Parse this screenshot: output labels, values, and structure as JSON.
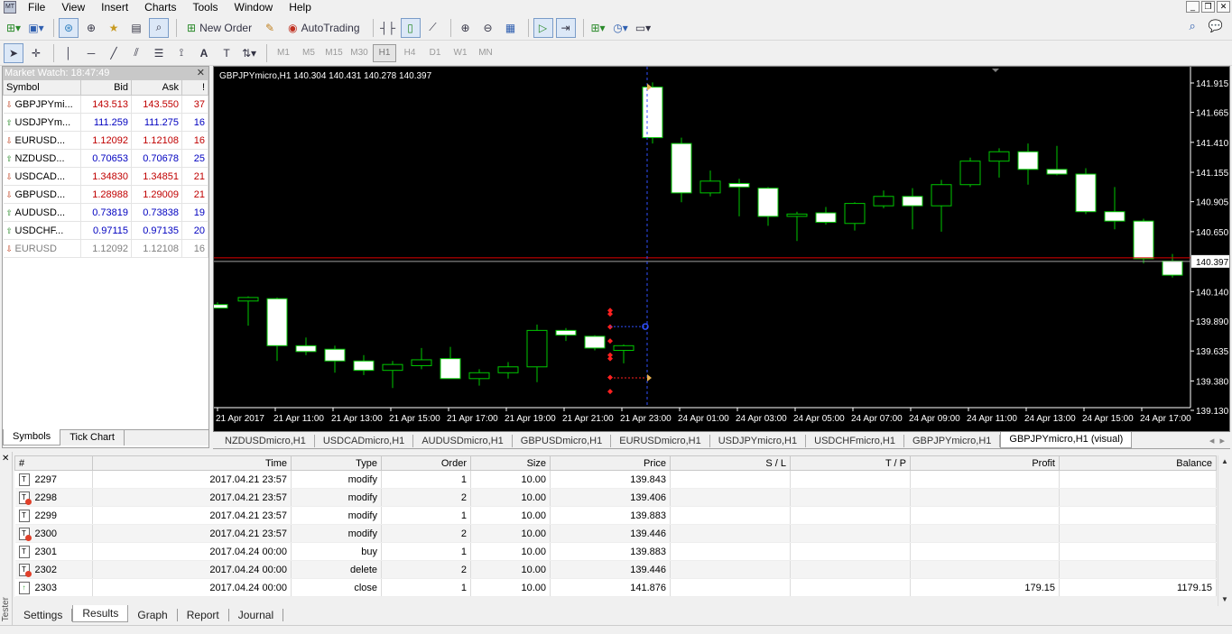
{
  "menu": {
    "items": [
      "File",
      "View",
      "Insert",
      "Charts",
      "Tools",
      "Window",
      "Help"
    ]
  },
  "toolbar": {
    "new_order_label": "New Order",
    "autotrading_label": "AutoTrading",
    "timeframes": [
      "M1",
      "M5",
      "M15",
      "M30",
      "H1",
      "H4",
      "D1",
      "W1",
      "MN"
    ],
    "active_timeframe": "H1"
  },
  "market_watch": {
    "title": "Market Watch: 18:47:49",
    "columns": [
      "Symbol",
      "Bid",
      "Ask",
      "!"
    ],
    "rows": [
      {
        "symbol": "GBPJPYmi...",
        "bid": "143.513",
        "ask": "143.550",
        "spread": "37",
        "dir": "down"
      },
      {
        "symbol": "USDJPYm...",
        "bid": "111.259",
        "ask": "111.275",
        "spread": "16",
        "dir": "up"
      },
      {
        "symbol": "EURUSD...",
        "bid": "1.12092",
        "ask": "1.12108",
        "spread": "16",
        "dir": "down"
      },
      {
        "symbol": "NZDUSD...",
        "bid": "0.70653",
        "ask": "0.70678",
        "spread": "25",
        "dir": "up"
      },
      {
        "symbol": "USDCAD...",
        "bid": "1.34830",
        "ask": "1.34851",
        "spread": "21",
        "dir": "down"
      },
      {
        "symbol": "GBPUSD...",
        "bid": "1.28988",
        "ask": "1.29009",
        "spread": "21",
        "dir": "down"
      },
      {
        "symbol": "AUDUSD...",
        "bid": "0.73819",
        "ask": "0.73838",
        "spread": "19",
        "dir": "up"
      },
      {
        "symbol": "USDCHF...",
        "bid": "0.97115",
        "ask": "0.97135",
        "spread": "20",
        "dir": "up"
      },
      {
        "symbol": "EURUSD",
        "bid": "1.12092",
        "ask": "1.12108",
        "spread": "16",
        "dir": "down-gray"
      }
    ],
    "tabs": [
      "Symbols",
      "Tick Chart"
    ]
  },
  "chart": {
    "header": "GBPJPYmicro,H1  140.304 140.431 140.278 140.397",
    "current_price": "140.397",
    "price_ticks": [
      "141.915",
      "141.665",
      "141.410",
      "141.155",
      "140.905",
      "140.650",
      "140.140",
      "139.890",
      "139.635",
      "139.380",
      "139.130"
    ],
    "time_ticks": [
      "21 Apr 2017",
      "21 Apr 11:00",
      "21 Apr 13:00",
      "21 Apr 15:00",
      "21 Apr 17:00",
      "21 Apr 19:00",
      "21 Apr 21:00",
      "21 Apr 23:00",
      "24 Apr 01:00",
      "24 Apr 03:00",
      "24 Apr 05:00",
      "24 Apr 07:00",
      "24 Apr 09:00",
      "24 Apr 11:00",
      "24 Apr 13:00",
      "24 Apr 15:00",
      "24 Apr 17:00"
    ],
    "colors": {
      "background": "#000000",
      "bull_fill": "#000000",
      "bear_fill": "#ffffff",
      "wick": "#00c800",
      "price_line": "#e00000",
      "crosshair": "#3050ff"
    }
  },
  "chart_tabs": {
    "items": [
      "NZDUSDmicro,H1",
      "USDCADmicro,H1",
      "AUDUSDmicro,H1",
      "GBPUSDmicro,H1",
      "EURUSDmicro,H1",
      "USDJPYmicro,H1",
      "USDCHFmicro,H1",
      "GBPJPYmicro,H1",
      "GBPJPYmicro,H1 (visual)"
    ],
    "active": "GBPJPYmicro,H1 (visual)"
  },
  "results": {
    "columns": [
      "#",
      "Time",
      "Type",
      "Order",
      "Size",
      "Price",
      "S / L",
      "T / P",
      "Profit",
      "Balance"
    ],
    "rows": [
      {
        "id": "2297",
        "time": "2017.04.21 23:57",
        "type": "modify",
        "order": "1",
        "size": "10.00",
        "price": "139.843",
        "sl": "",
        "tp": "",
        "profit": "",
        "balance": "",
        "icon": "modify-buy"
      },
      {
        "id": "2298",
        "time": "2017.04.21 23:57",
        "type": "modify",
        "order": "2",
        "size": "10.00",
        "price": "139.406",
        "sl": "",
        "tp": "",
        "profit": "",
        "balance": "",
        "icon": "modify-sell"
      },
      {
        "id": "2299",
        "time": "2017.04.21 23:57",
        "type": "modify",
        "order": "1",
        "size": "10.00",
        "price": "139.883",
        "sl": "",
        "tp": "",
        "profit": "",
        "balance": "",
        "icon": "modify-buy"
      },
      {
        "id": "2300",
        "time": "2017.04.21 23:57",
        "type": "modify",
        "order": "2",
        "size": "10.00",
        "price": "139.446",
        "sl": "",
        "tp": "",
        "profit": "",
        "balance": "",
        "icon": "modify-sell"
      },
      {
        "id": "2301",
        "time": "2017.04.24 00:00",
        "type": "buy",
        "order": "1",
        "size": "10.00",
        "price": "139.883",
        "sl": "",
        "tp": "",
        "profit": "",
        "balance": "",
        "icon": "buy"
      },
      {
        "id": "2302",
        "time": "2017.04.24 00:00",
        "type": "delete",
        "order": "2",
        "size": "10.00",
        "price": "139.446",
        "sl": "",
        "tp": "",
        "profit": "",
        "balance": "",
        "icon": "delete"
      },
      {
        "id": "2303",
        "time": "2017.04.24 00:00",
        "type": "close",
        "order": "1",
        "size": "10.00",
        "price": "141.876",
        "sl": "",
        "tp": "",
        "profit": "179.15",
        "balance": "1179.15",
        "icon": "close"
      }
    ]
  },
  "tester": {
    "side_label": "Tester",
    "tabs": [
      "Settings",
      "Results",
      "Graph",
      "Report",
      "Journal"
    ],
    "active_tab": "Results"
  },
  "chart_data": {
    "type": "candlestick",
    "symbol": "GBPJPYmicro",
    "timeframe": "H1",
    "ylim": [
      139.13,
      142.0
    ],
    "candles": [
      {
        "o": 140.03,
        "h": 140.05,
        "l": 140.0,
        "c": 140.0
      },
      {
        "o": 140.06,
        "h": 140.1,
        "l": 139.85,
        "c": 140.09
      },
      {
        "o": 140.08,
        "h": 140.09,
        "l": 139.55,
        "c": 139.68
      },
      {
        "o": 139.68,
        "h": 139.75,
        "l": 139.6,
        "c": 139.63
      },
      {
        "o": 139.65,
        "h": 139.68,
        "l": 139.45,
        "c": 139.55
      },
      {
        "o": 139.55,
        "h": 139.6,
        "l": 139.43,
        "c": 139.47
      },
      {
        "o": 139.47,
        "h": 139.55,
        "l": 139.32,
        "c": 139.52
      },
      {
        "o": 139.51,
        "h": 139.66,
        "l": 139.48,
        "c": 139.56
      },
      {
        "o": 139.57,
        "h": 139.67,
        "l": 139.43,
        "c": 139.4
      },
      {
        "o": 139.4,
        "h": 139.48,
        "l": 139.34,
        "c": 139.45
      },
      {
        "o": 139.45,
        "h": 139.54,
        "l": 139.4,
        "c": 139.5
      },
      {
        "o": 139.5,
        "h": 139.86,
        "l": 139.37,
        "c": 139.81
      },
      {
        "o": 139.81,
        "h": 139.83,
        "l": 139.72,
        "c": 139.77
      },
      {
        "o": 139.76,
        "h": 139.77,
        "l": 139.64,
        "c": 139.66
      },
      {
        "o": 139.64,
        "h": 139.69,
        "l": 139.53,
        "c": 139.68
      },
      {
        "o": 141.88,
        "h": 141.92,
        "l": 141.4,
        "c": 141.45
      },
      {
        "o": 141.4,
        "h": 141.45,
        "l": 140.9,
        "c": 140.98
      },
      {
        "o": 140.98,
        "h": 141.17,
        "l": 140.95,
        "c": 141.08
      },
      {
        "o": 141.06,
        "h": 141.1,
        "l": 140.78,
        "c": 141.03
      },
      {
        "o": 141.02,
        "h": 141.03,
        "l": 140.7,
        "c": 140.78
      },
      {
        "o": 140.78,
        "h": 140.82,
        "l": 140.57,
        "c": 140.8
      },
      {
        "o": 140.81,
        "h": 140.86,
        "l": 140.71,
        "c": 140.73
      },
      {
        "o": 140.72,
        "h": 140.9,
        "l": 140.66,
        "c": 140.89
      },
      {
        "o": 140.87,
        "h": 141.0,
        "l": 140.85,
        "c": 140.95
      },
      {
        "o": 140.95,
        "h": 141.02,
        "l": 140.67,
        "c": 140.87
      },
      {
        "o": 140.87,
        "h": 141.09,
        "l": 140.65,
        "c": 141.05
      },
      {
        "o": 141.05,
        "h": 141.28,
        "l": 141.03,
        "c": 141.25
      },
      {
        "o": 141.25,
        "h": 141.36,
        "l": 141.11,
        "c": 141.33
      },
      {
        "o": 141.33,
        "h": 141.4,
        "l": 141.05,
        "c": 141.18
      },
      {
        "o": 141.18,
        "h": 141.38,
        "l": 141.13,
        "c": 141.14
      },
      {
        "o": 141.14,
        "h": 141.19,
        "l": 140.8,
        "c": 140.82
      },
      {
        "o": 140.82,
        "h": 141.03,
        "l": 140.67,
        "c": 140.74
      },
      {
        "o": 140.74,
        "h": 140.76,
        "l": 140.38,
        "c": 140.42
      },
      {
        "o": 140.4,
        "h": 140.46,
        "l": 140.26,
        "c": 140.28
      }
    ]
  }
}
